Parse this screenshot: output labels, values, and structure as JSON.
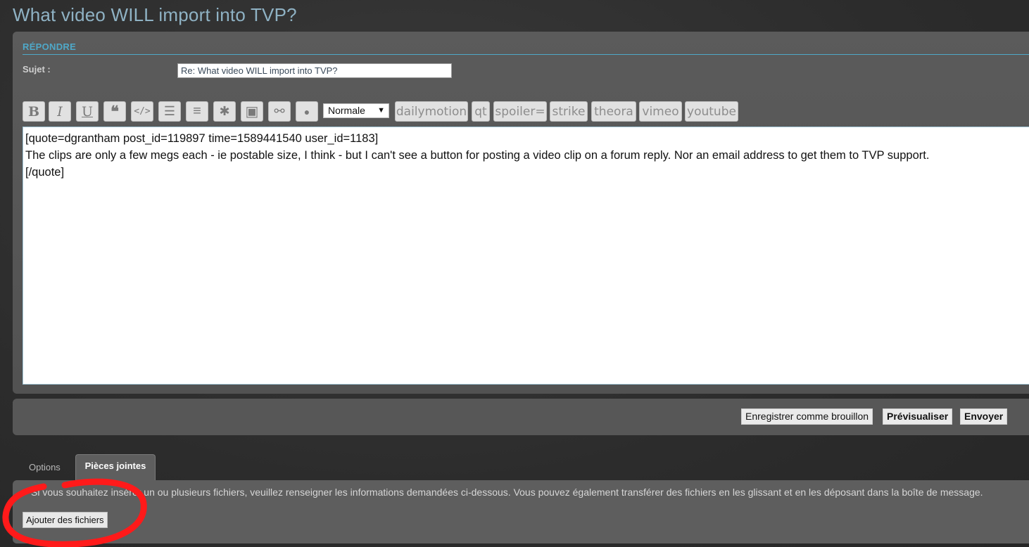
{
  "page": {
    "title": "What video WILL import into TVP?"
  },
  "reply": {
    "section_title": "RÉPONDRE",
    "subject_label": "Sujet :",
    "subject_value": "Re: What video WILL import into TVP?"
  },
  "toolbar": {
    "buttons": [
      {
        "icon": "bold-icon",
        "glyph": "B"
      },
      {
        "icon": "italic-icon",
        "glyph": "I"
      },
      {
        "icon": "underline-icon",
        "glyph": "U"
      },
      {
        "icon": "quote-icon",
        "glyph": "❝"
      },
      {
        "icon": "code-icon",
        "glyph": "</>"
      },
      {
        "icon": "list-icon",
        "glyph": "☰"
      },
      {
        "icon": "ordered-list-icon",
        "glyph": "≡"
      },
      {
        "icon": "list-item-icon",
        "glyph": "✱"
      },
      {
        "icon": "image-icon",
        "glyph": "▣"
      },
      {
        "icon": "link-icon",
        "glyph": "⚯"
      },
      {
        "icon": "color-icon",
        "glyph": "●"
      }
    ],
    "font_size_select": "Normale",
    "custom_tags": [
      "dailymotion",
      "qt",
      "spoiler=",
      "strike",
      "theora",
      "vimeo",
      "youtube"
    ]
  },
  "editor": {
    "content": "[quote=dgrantham post_id=119897 time=1589441540 user_id=1183]\nThe clips are only a few megs each - ie postable size, I think - but I can't see a button for posting a video clip on a forum reply. Nor an email address to get them to TVP support.\n[/quote]"
  },
  "actions": {
    "save_draft": "Enregistrer comme brouillon",
    "preview": "Prévisualiser",
    "submit": "Envoyer"
  },
  "tabs": {
    "options": "Options",
    "attachments": "Pièces jointes"
  },
  "attachments": {
    "info": "Si vous souhaitez insérer un ou plusieurs fichiers, veuillez renseigner les informations demandées ci-dessous. Vous pouvez également transférer des fichiers en les glissant et en les déposant dans la boîte de message.",
    "add_files": "Ajouter des fichiers"
  },
  "colors": {
    "accent": "#4fa8c8",
    "title": "#8fb2c4",
    "annotation": "#ff1a1a"
  }
}
